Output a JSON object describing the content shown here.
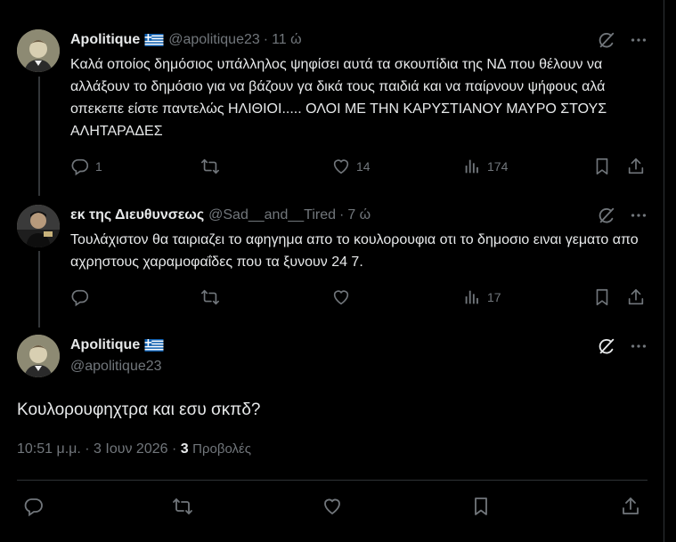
{
  "colors": {
    "background": "#000000",
    "text": "#e7e9ea",
    "muted": "#71767b",
    "border": "#2f3336"
  },
  "tweets": [
    {
      "name": "Apolitique",
      "flag": "greece-flag-icon",
      "handle": "@apolitique23",
      "time": "11 ώ",
      "text": "Καλά οποίος δημόσιος υπάλληλος ψηφίσει αυτά τα σκουπίδια της ΝΔ που θέλουν να αλλάξουν το δημόσιο για να βάζουν γα δικά τους παιδιά και να παίρνουν ψήφους αλά οπεκεπε είστε παντελώς ΗΛΙΘΙΟΙ..... ΟΛΟΙ ΜΕ ΤΗΝ ΚΑΡΥΣΤΙΑΝΟΥ ΜΑΥΡΟ ΣΤΟΥΣ ΑΛΗΤΑΡΑΔΕΣ",
      "replies": "1",
      "reposts": "",
      "likes": "14",
      "views": "174"
    },
    {
      "name": "εκ της Διευθυνσεως",
      "handle": "@Sad__and__Tired",
      "time": "7 ώ",
      "text": "Τουλάχιστον θα ταιριαζει το αφηγημα απο το κουλορουφια οτι το δημοσιο ειναι γεματο απο αχρηστους χαραμοφαΐδες που τα ξυνουν 24 7.",
      "replies": "",
      "reposts": "",
      "likes": "",
      "views": "17"
    }
  ],
  "main_tweet": {
    "name": "Apolitique",
    "flag": "greece-flag-icon",
    "handle": "@apolitique23",
    "text": "Κουλορουφηχτρα και εσυ σκπδ?",
    "timestamp": "10:51 μ.μ. · 3 Ιουν 2026",
    "views_count": "3",
    "views_label": "Προβολές"
  }
}
